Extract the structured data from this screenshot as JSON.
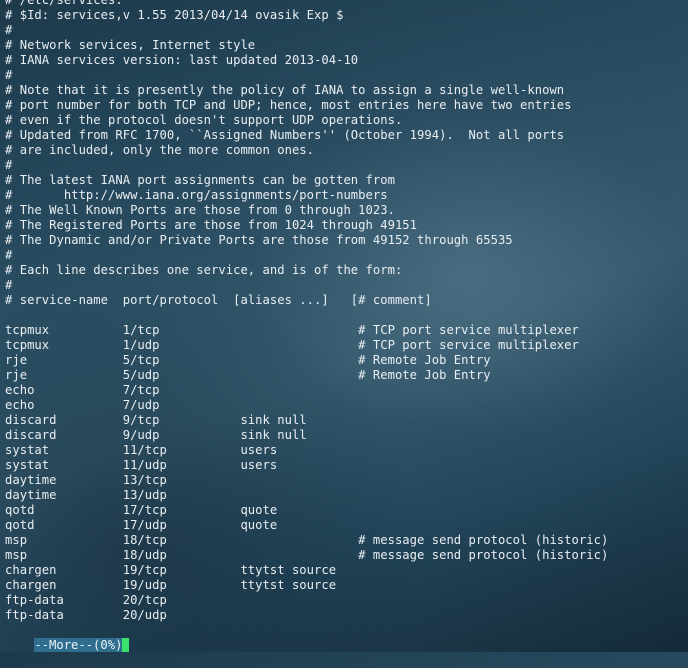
{
  "file_lines": [
    "# /etc/services:",
    "# $Id: services,v 1.55 2013/04/14 ovasik Exp $",
    "#",
    "# Network services, Internet style",
    "# IANA services version: last updated 2013-04-10",
    "#",
    "# Note that it is presently the policy of IANA to assign a single well-known",
    "# port number for both TCP and UDP; hence, most entries here have two entries",
    "# even if the protocol doesn't support UDP operations.",
    "# Updated from RFC 1700, ``Assigned Numbers'' (October 1994).  Not all ports",
    "# are included, only the more common ones.",
    "#",
    "# The latest IANA port assignments can be gotten from",
    "#       http://www.iana.org/assignments/port-numbers",
    "# The Well Known Ports are those from 0 through 1023.",
    "# The Registered Ports are those from 1024 through 49151",
    "# The Dynamic and/or Private Ports are those from 49152 through 65535",
    "#",
    "# Each line describes one service, and is of the form:",
    "#",
    "# service-name  port/protocol  [aliases ...]   [# comment]",
    "",
    "tcpmux          1/tcp                           # TCP port service multiplexer",
    "tcpmux          1/udp                           # TCP port service multiplexer",
    "rje             5/tcp                           # Remote Job Entry",
    "rje             5/udp                           # Remote Job Entry",
    "echo            7/tcp",
    "echo            7/udp",
    "discard         9/tcp           sink null",
    "discard         9/udp           sink null",
    "systat          11/tcp          users",
    "systat          11/udp          users",
    "daytime         13/tcp",
    "daytime         13/udp",
    "qotd            17/tcp          quote",
    "qotd            17/udp          quote",
    "msp             18/tcp                          # message send protocol (historic)",
    "msp             18/udp                          # message send protocol (historic)",
    "chargen         19/tcp          ttytst source",
    "chargen         19/udp          ttytst source",
    "ftp-data        20/tcp",
    "ftp-data        20/udp"
  ],
  "pager": {
    "prompt": "--More--(0%)",
    "progress_percent": 0
  },
  "colors": {
    "text": "#e8eef2",
    "pager_highlight": "#2f6e8e",
    "cursor": "#39e36b"
  }
}
